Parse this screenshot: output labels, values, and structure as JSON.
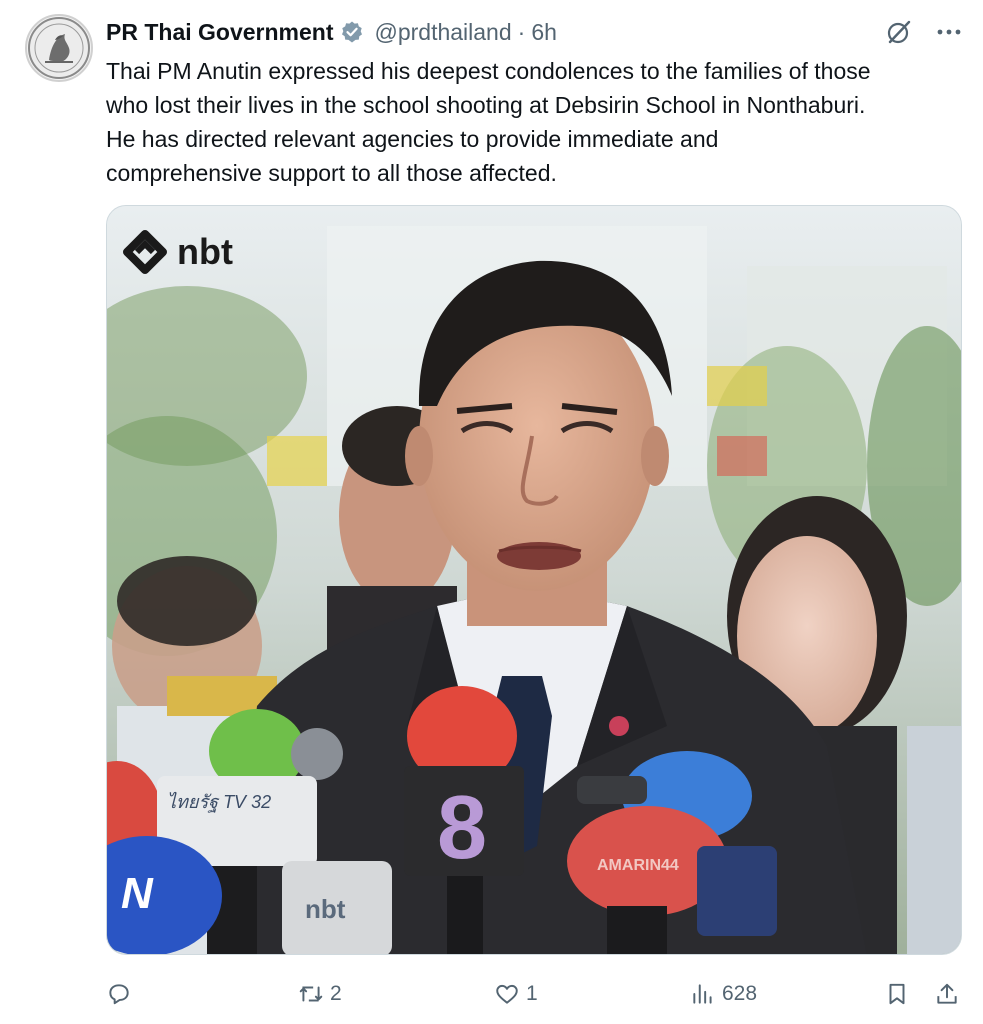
{
  "author": {
    "name": "PR Thai Government",
    "handle": "@prdthailand",
    "separator": "·",
    "time": "6h"
  },
  "tweet": {
    "lines": [
      "Thai PM Anutin expressed his deepest condolences to the families of those",
      "who lost their lives in the school shooting at Debsirin School in Nonthaburi.",
      "He has directed relevant agencies to provide immediate and",
      "comprehensive support to all those affected."
    ]
  },
  "media": {
    "watermark": "nbt",
    "mic_labels": {
      "tnews": "ไทยรัฐ TV 32",
      "ch8": "8",
      "nbt": "nbt",
      "n": "N",
      "amarin": "AMARIN44"
    }
  },
  "actions": {
    "reply_count": "",
    "retweet_count": "2",
    "like_count": "1",
    "views_count": "628"
  },
  "icons": {
    "verified": "verified-badge-icon",
    "grok": "grok-icon",
    "more": "more-icon",
    "reply": "reply-icon",
    "retweet": "retweet-icon",
    "like": "like-icon",
    "views": "views-icon",
    "bookmark": "bookmark-icon",
    "share": "share-icon"
  },
  "colors": {
    "text": "#0f1419",
    "secondary": "#536471",
    "verified_badge": "#829aab"
  }
}
